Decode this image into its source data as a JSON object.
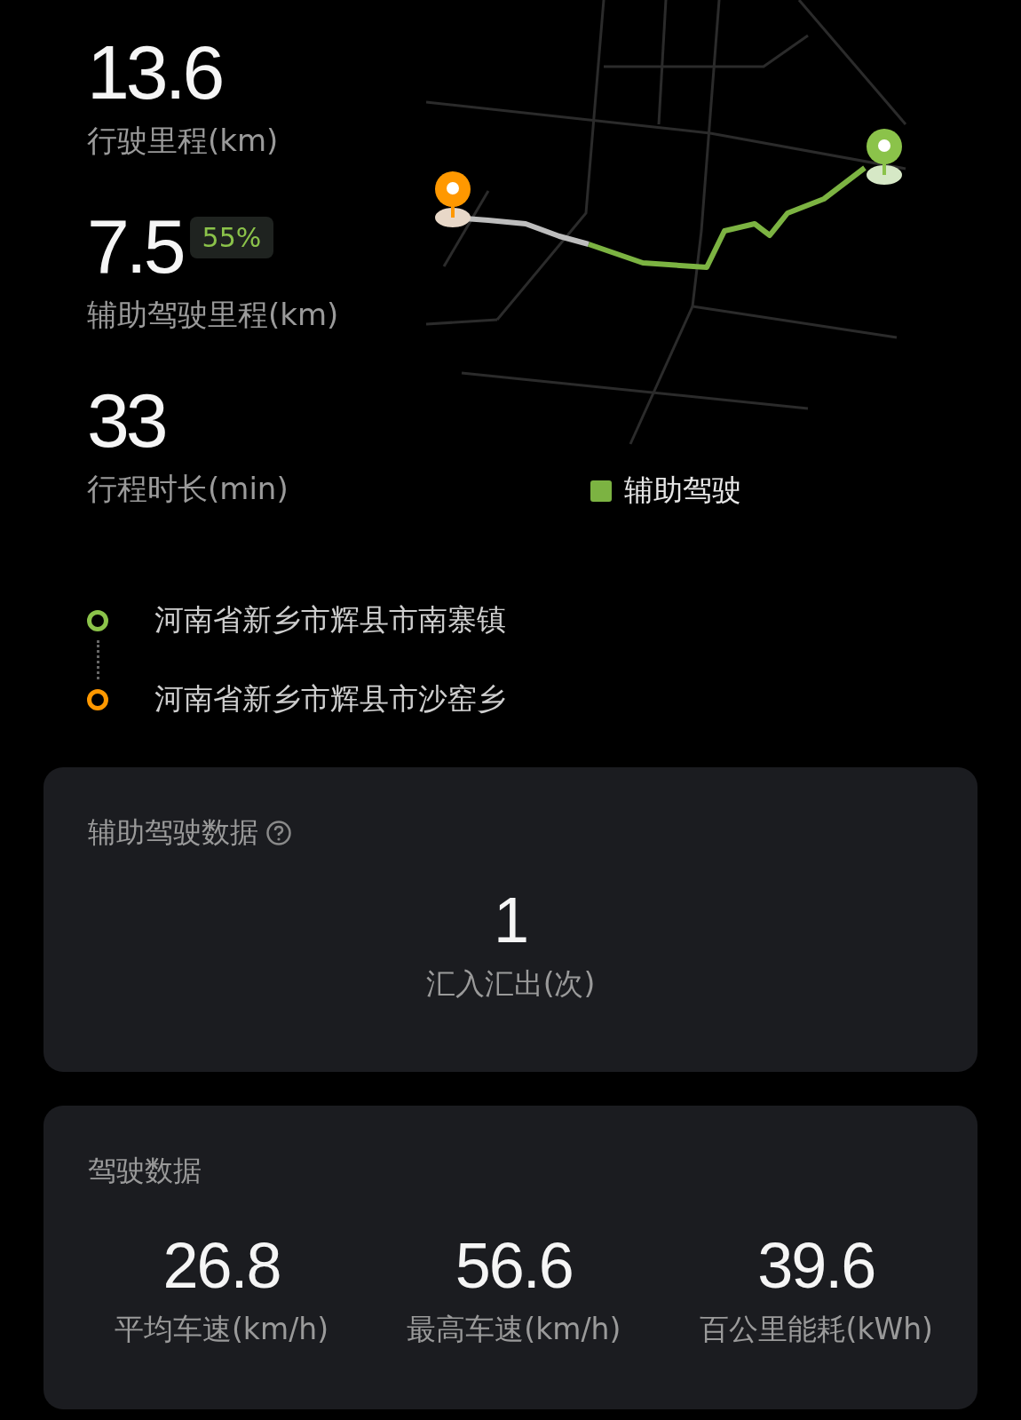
{
  "summary": {
    "stats": [
      {
        "value": "13.6",
        "label": "行驶里程(km)"
      },
      {
        "value": "7.5",
        "badge": "55%",
        "label": "辅助驾驶里程(km)"
      },
      {
        "value": "33",
        "label": "行程时长(min)"
      }
    ],
    "map": {
      "legend": [
        {
          "label": "辅助驾驶",
          "color": "#7cb342"
        }
      ]
    }
  },
  "route": [
    {
      "address": "河南省新乡市辉县市南寨镇",
      "color": "#8bc34a"
    },
    {
      "address": "河南省新乡市辉县市沙窑乡",
      "color": "#ff9800"
    }
  ],
  "assist_card": {
    "title": "辅助驾驶数据",
    "stats": [
      {
        "value": "1",
        "label": "汇入汇出(次)"
      }
    ]
  },
  "driving_card": {
    "title": "驾驶数据",
    "stats": [
      {
        "value": "26.8",
        "label": "平均车速(km/h)"
      },
      {
        "value": "56.6",
        "label": "最高车速(km/h)"
      },
      {
        "value": "39.6",
        "label": "百公里能耗(kWh)"
      }
    ]
  }
}
